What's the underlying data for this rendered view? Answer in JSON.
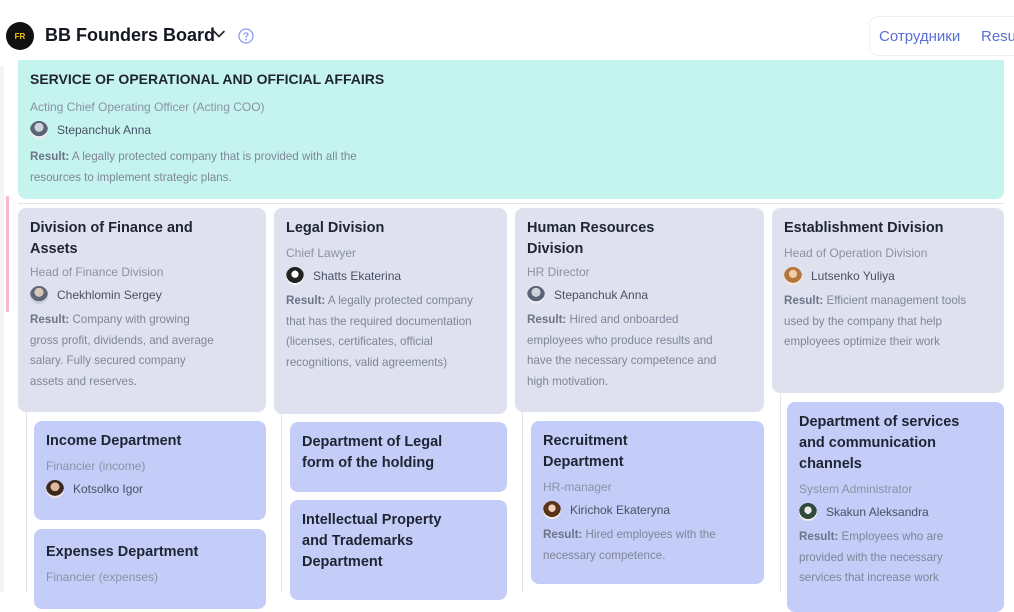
{
  "header": {
    "logo_text": "FR",
    "board_title": "BB Founders Board",
    "tabs": [
      "Сотрудники",
      "Resu"
    ]
  },
  "top_card": {
    "title": "SERVICE OF OPERATIONAL AND OFFICIAL AFFAIRS",
    "role": "Acting Chief Operating Officer (Acting COO)",
    "person": "Stepanchuk Anna",
    "result_label": "Result:",
    "result_text": "A legally protected company that is provided with all the resources to implement strategic plans."
  },
  "divisions": [
    {
      "title": "Division of Finance and Assets",
      "role": "Head of Finance Division",
      "person": "Chekhlomin Sergey",
      "result_label": "Result:",
      "result_text": "Company with growing gross profit, dividends, and average salary. Fully secured company assets and reserves."
    },
    {
      "title": "Legal Division",
      "role": "Chief Lawyer",
      "person": "Shatts Ekaterina",
      "result_label": "Result:",
      "result_text": "A legally protected company that has the required documentation (licenses, certificates, official recognitions, valid agreements)"
    },
    {
      "title": "Human Resources Division",
      "role": "HR Director",
      "person": "Stepanchuk Anna",
      "result_label": "Result:",
      "result_text": "Hired and onboarded employees who produce results and have the necessary competence and high motivation."
    },
    {
      "title": "Establishment Division",
      "role": "Head of Operation Division",
      "person": "Lutsenko Yuliya",
      "result_label": "Result:",
      "result_text": "Efficient management tools used by the company that help employees optimize their work"
    }
  ],
  "departments": {
    "income": {
      "title": "Income Department",
      "role": "Financier (income)",
      "person": "Kotsolko Igor"
    },
    "expenses": {
      "title": "Expenses Department",
      "role": "Financier (expenses)"
    },
    "legal_form": {
      "title": "Department of Legal form of the holding"
    },
    "ip": {
      "title": "Intellectual Property and Trademarks Department"
    },
    "recruitment": {
      "title": "Recruitment Department",
      "role": "HR-manager",
      "person": "Kirichok Ekateryna",
      "result_label": "Result:",
      "result_text": "Hired employees with the necessary competence."
    },
    "services": {
      "title": "Department of services and communication channels",
      "role": "System Administrator",
      "person": "Skakun Aleksandra",
      "result_label": "Result:",
      "result_text": "Employees who are provided with the necessary services that increase work"
    }
  },
  "colors": {
    "teal_card": "#c5f4ee",
    "division_card": "#dfe1ef",
    "department_card": "#c3cdf8",
    "nav_accent": "#5a6fd6"
  }
}
